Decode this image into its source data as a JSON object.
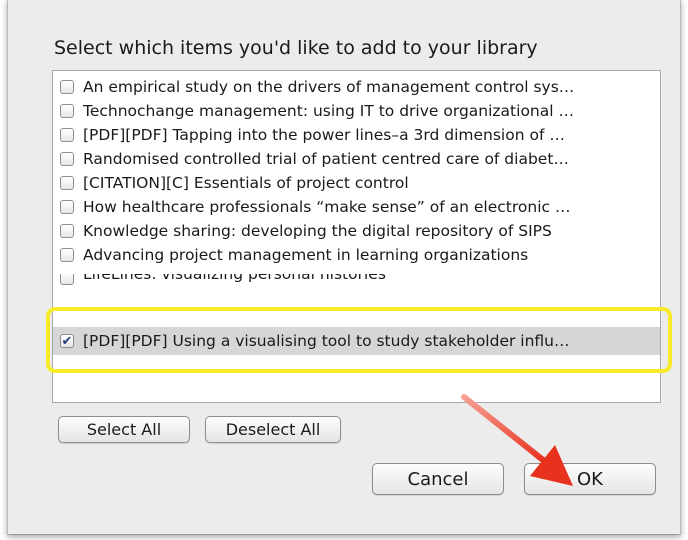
{
  "dialog": {
    "prompt": "Select which items you'd like to add to your library",
    "items": [
      {
        "label": "An empirical study on the drivers of management control sys…",
        "checked": false
      },
      {
        "label": "Technochange management: using IT to drive organizational …",
        "checked": false
      },
      {
        "label": "[PDF][PDF] Tapping into the power lines–a 3rd dimension of …",
        "checked": false
      },
      {
        "label": "Randomised controlled trial of patient centred care of diabet…",
        "checked": false
      },
      {
        "label": "[CITATION][C] Essentials of project control",
        "checked": false
      },
      {
        "label": "How healthcare professionals “make sense” of an electronic …",
        "checked": false
      },
      {
        "label": "Knowledge sharing: developing the digital repository of SIPS",
        "checked": false
      },
      {
        "label": "Advancing project management in learning organizations",
        "checked": false
      },
      {
        "label": "LifeLines: visualizing personal histories",
        "checked": false
      },
      {
        "label": "[PDF][PDF] Using a visualising tool to study stakeholder influ…",
        "checked": true
      }
    ],
    "buttons": {
      "select_all": "Select All",
      "deselect_all": "Deselect All",
      "cancel": "Cancel",
      "ok": "OK"
    },
    "check_mark": "✔"
  },
  "annotation": {
    "highlight_color": "#f7ea2a",
    "arrow_color": "#e8321e"
  }
}
